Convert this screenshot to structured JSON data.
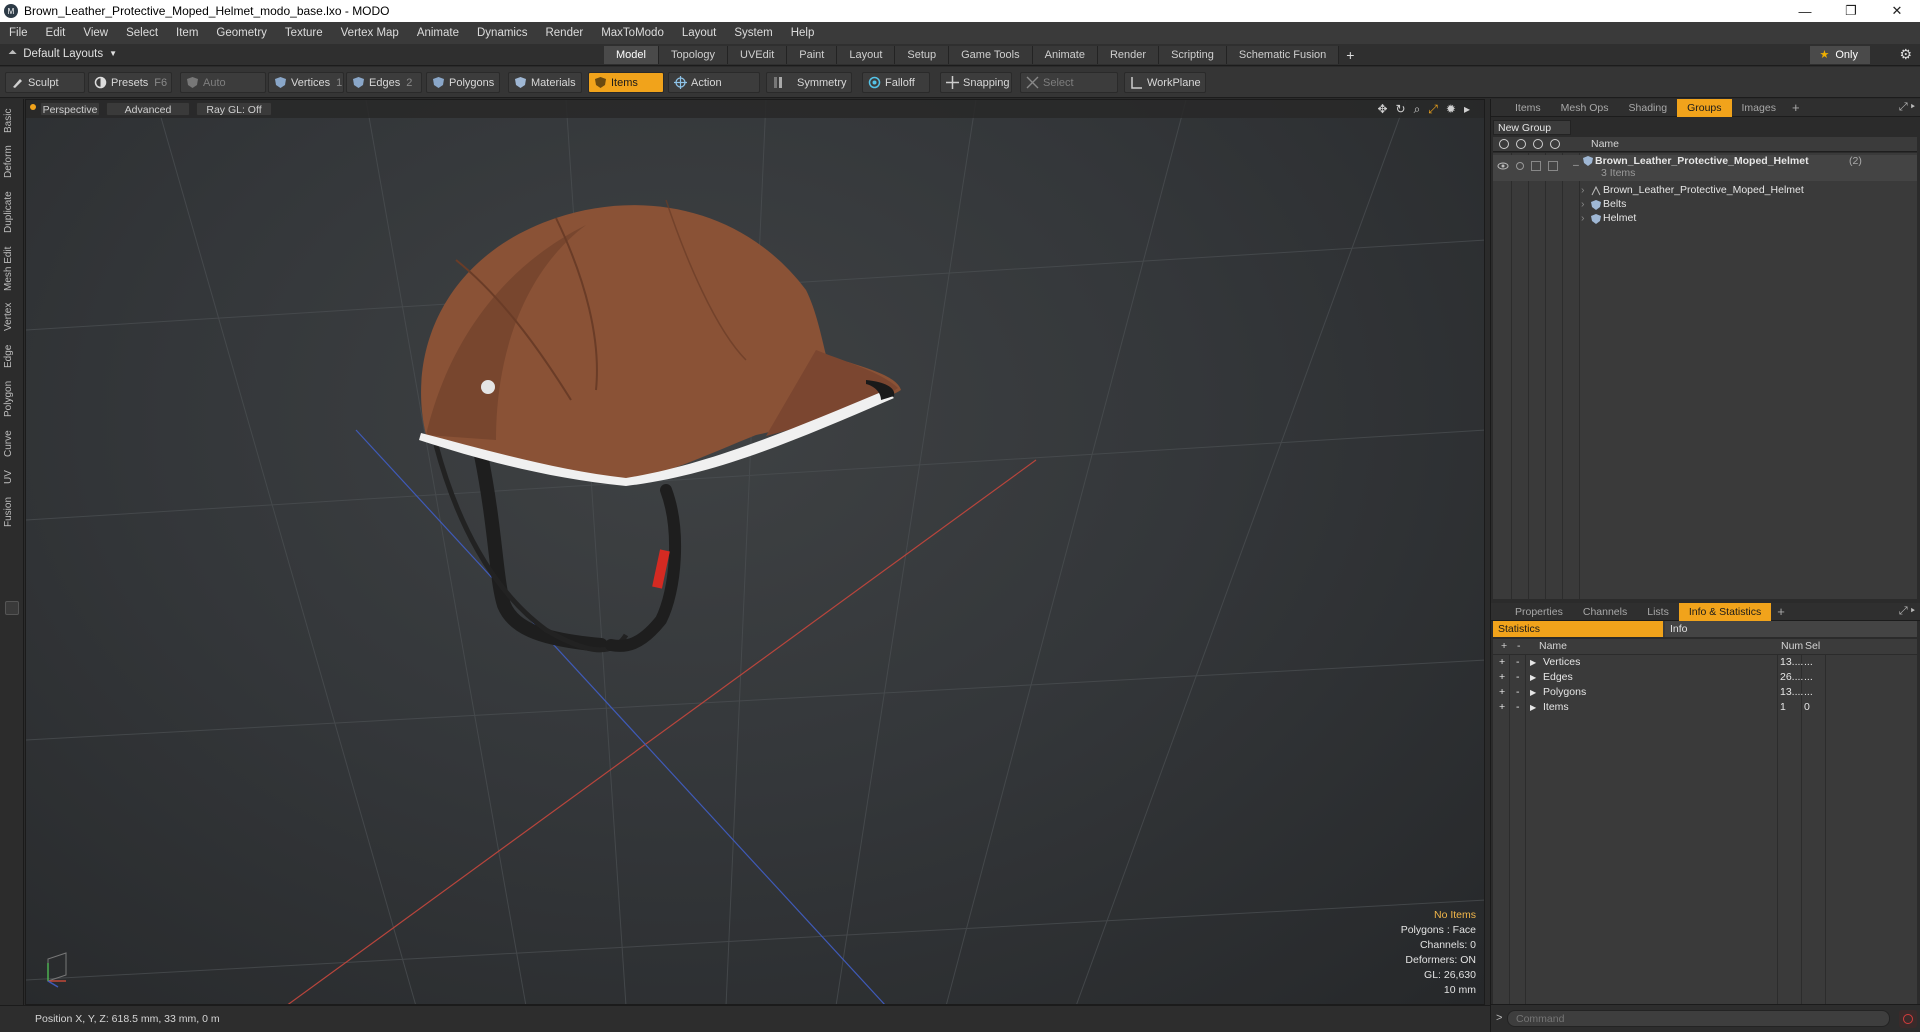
{
  "window": {
    "title": "Brown_Leather_Protective_Moped_Helmet_modo_base.lxo - MODO",
    "app_icon": "M",
    "controls": [
      "—",
      "❐",
      "✕"
    ]
  },
  "menubar": {
    "items": [
      "File",
      "Edit",
      "View",
      "Select",
      "Item",
      "Geometry",
      "Texture",
      "Vertex Map",
      "Animate",
      "Dynamics",
      "Render",
      "MaxToModo",
      "Layout",
      "System",
      "Help"
    ]
  },
  "layout_bar": {
    "layout_select": "Default Layouts",
    "tabs": [
      "Model",
      "Topology",
      "UVEdit",
      "Paint",
      "Layout",
      "Setup",
      "Game Tools",
      "Animate",
      "Render",
      "Scripting",
      "Schematic Fusion"
    ],
    "active_tab": "Model",
    "add_tab": "+",
    "only_label": "Only"
  },
  "toolbar": {
    "sculpt": "Sculpt",
    "presets": "Presets",
    "presets_key": "F6",
    "auto_select": "Auto Select",
    "vertices": "Vertices",
    "vertices_num": "1",
    "edges": "Edges",
    "edges_num": "2",
    "polygons": "Polygons",
    "materials": "Materials",
    "items": "Items",
    "action_center": "Action Center",
    "symmetry": "Symmetry",
    "falloff": "Falloff",
    "snapping": "Snapping",
    "select_through": "Select Through",
    "workplane": "WorkPlane"
  },
  "left_tabs": [
    "Basic",
    "Deform",
    "Duplicate",
    "Mesh Edit",
    "Vertex",
    "Edge",
    "Polygon",
    "Curve",
    "UV",
    "Fusion"
  ],
  "viewport": {
    "view_mode": "Perspective",
    "shading": "Advanced",
    "raygl": "Ray GL: Off",
    "stats": {
      "no_items": "No Items",
      "polygons": "Polygons : Face",
      "channels": "Channels: 0",
      "deformers": "Deformers: ON",
      "gl": "GL: 26,630",
      "unit": "10 mm"
    },
    "colors": {
      "leather": "#8a5236",
      "leather_dark": "#5e3422",
      "trim": "#f0f0f0",
      "strap": "#1e1e1e",
      "buckle": "#d42a22"
    }
  },
  "statusbar": {
    "position": "Position X, Y, Z:  618.5 mm, 33 mm, 0 m"
  },
  "top_panel": {
    "tabs": [
      "Items",
      "Mesh Ops",
      "Shading",
      "Groups",
      "Images"
    ],
    "active_tab": "Groups",
    "add": "+",
    "new_group": "New Group",
    "column_name": "Name",
    "group_name": "Brown_Leather_Protective_Moped_Helmet",
    "group_count": "(2)",
    "group_sub": "3 Items",
    "children": [
      "Brown_Leather_Protective_Moped_Helmet",
      "Belts",
      "Helmet"
    ]
  },
  "bottom_panel": {
    "tabs": [
      "Properties",
      "Channels",
      "Lists",
      "Info & Statistics"
    ],
    "active_tab": "Info & Statistics",
    "add": "+",
    "sub_tabs": [
      "Statistics",
      "Info"
    ],
    "columns": {
      "name": "Name",
      "num": "Num",
      "sel": "Sel"
    },
    "rows": [
      {
        "name": "Vertices",
        "num": "13....",
        "sel": "..."
      },
      {
        "name": "Edges",
        "num": "26....",
        "sel": "..."
      },
      {
        "name": "Polygons",
        "num": "13....",
        "sel": "..."
      },
      {
        "name": "Items",
        "num": "1",
        "sel": "0"
      }
    ]
  },
  "command": {
    "prompt": ">",
    "placeholder": "Command"
  },
  "accent_color": "#f1a31b"
}
